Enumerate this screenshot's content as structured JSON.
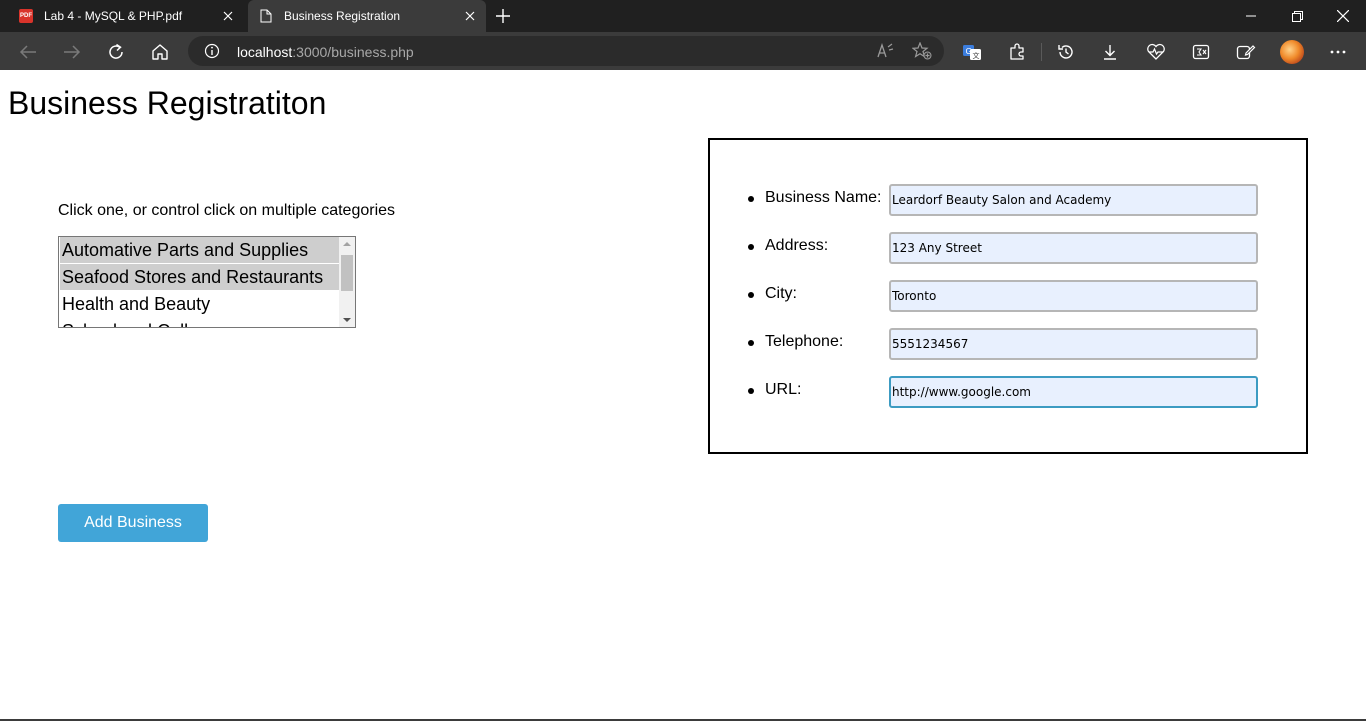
{
  "browser": {
    "tabs": [
      {
        "title": "Lab 4 - MySQL & PHP.pdf",
        "icon": "pdf-icon",
        "active": false
      },
      {
        "title": "Business Registration",
        "icon": "page-icon",
        "active": true
      }
    ],
    "address": {
      "host": "localhost",
      "path": ":3000/business.php"
    },
    "favicon_badge": "PDF"
  },
  "page": {
    "title": "Business Registratiton",
    "instructions": "Click one, or control click on multiple categories",
    "categories": [
      {
        "label": "Automative Parts and Supplies",
        "selected": true
      },
      {
        "label": "Seafood Stores and Restaurants",
        "selected": true
      },
      {
        "label": "Health and Beauty",
        "selected": false
      },
      {
        "label": "School and Colleges",
        "selected": false
      }
    ],
    "form": {
      "business_name": {
        "label": "Business Name:",
        "value": "Leardorf Beauty Salon and Academy"
      },
      "address": {
        "label": "Address:",
        "value": "123 Any Street"
      },
      "city": {
        "label": "City:",
        "value": "Toronto"
      },
      "telephone": {
        "label": "Telephone:",
        "value": "5551234567"
      },
      "url": {
        "label": "URL:",
        "value": "http://www.google.com"
      }
    },
    "submit_label": "Add Business"
  },
  "colors": {
    "button": "#41a5d8",
    "input_bg": "#e8f0fe",
    "focus_border": "#3c9bc2",
    "selected_option": "#cecece",
    "chrome_dark": "#202020",
    "chrome_toolbar": "#3b3b3b"
  }
}
